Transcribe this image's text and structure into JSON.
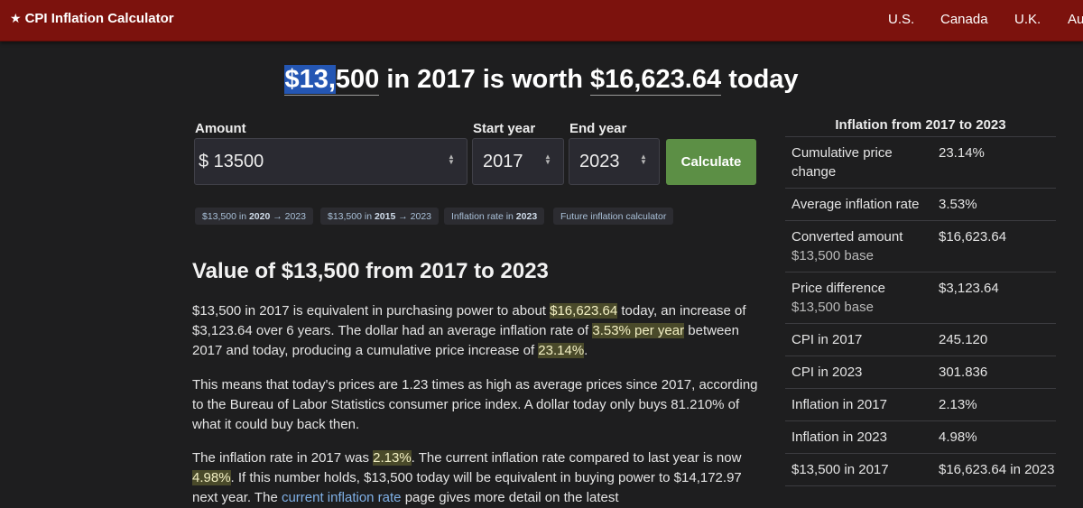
{
  "header": {
    "brand_icon": "star-icon",
    "brand": "CPI Inflation Calculator",
    "nav": [
      "U.S.",
      "Canada",
      "U.K.",
      "Au"
    ]
  },
  "headline": {
    "amount_selected": "$13,",
    "amount_rest": "500",
    "mid": " in 2017 is worth ",
    "result": "$16,623.64",
    "end": " today"
  },
  "form": {
    "amount_label": "Amount",
    "amount_value": "$ 13500",
    "start_label": "Start year",
    "start_value": "2017",
    "end_label": "End year",
    "end_value": "2023",
    "calculate_label": "Calculate"
  },
  "chips": [
    {
      "pre": "$13,500 in ",
      "bold": "2020",
      "post": " → 2023"
    },
    {
      "pre": "$13,500 in ",
      "bold": "2015",
      "post": " → 2023"
    },
    {
      "pre": "Inflation rate in ",
      "bold": "2023",
      "post": ""
    },
    {
      "pre": "Future inflation calculator",
      "bold": "",
      "post": ""
    }
  ],
  "article": {
    "title": "Value of $13,500 from 2017 to 2023",
    "p1": {
      "a": "$13,500 in 2017 is equivalent in purchasing power to about ",
      "h1": "$16,623.64",
      "b": " today, an increase of $3,123.64 over 6 years. The dollar had an average inflation rate of ",
      "h2": "3.53% per year",
      "c": " between 2017 and today, producing a cumulative price increase of ",
      "h3": "23.14%",
      "d": "."
    },
    "p2": "This means that today's prices are 1.23 times as high as average prices since 2017, according to the Bureau of Labor Statistics consumer price index. A dollar today only buys 81.210% of what it could buy back then.",
    "p3": {
      "a": "The inflation rate in 2017 was ",
      "h1": "2.13%",
      "b": ". The current inflation rate compared to last year is now ",
      "h2": "4.98%",
      "c": ". If this number holds, $13,500 today will be equivalent in buying power to $14,172.97 next year. The ",
      "link": "current inflation rate",
      "d": " page gives more detail on the latest"
    }
  },
  "stats": {
    "title": "Inflation from 2017 to 2023",
    "rows": [
      {
        "label": "Cumulative price change",
        "sub": "",
        "value": "23.14%"
      },
      {
        "label": "Average inflation rate",
        "sub": "",
        "value": "3.53%"
      },
      {
        "label": "Converted amount",
        "sub": "$13,500 base",
        "value": "$16,623.64"
      },
      {
        "label": "Price difference",
        "sub": "$13,500 base",
        "value": "$3,123.64"
      },
      {
        "label": "CPI in 2017",
        "sub": "",
        "value": "245.120"
      },
      {
        "label": "CPI in 2023",
        "sub": "",
        "value": "301.836"
      },
      {
        "label": "Inflation in 2017",
        "sub": "",
        "value": "2.13%"
      },
      {
        "label": "Inflation in 2023",
        "sub": "",
        "value": "4.98%"
      },
      {
        "label": "$13,500 in 2017",
        "sub": "",
        "value": "$16,623.64 in 2023"
      }
    ]
  },
  "colors": {
    "header_bg": "#7c120d",
    "page_bg": "#1e1e1f",
    "button": "#5c8f45",
    "selection": "#2456b3",
    "link": "#7fb0e6"
  }
}
